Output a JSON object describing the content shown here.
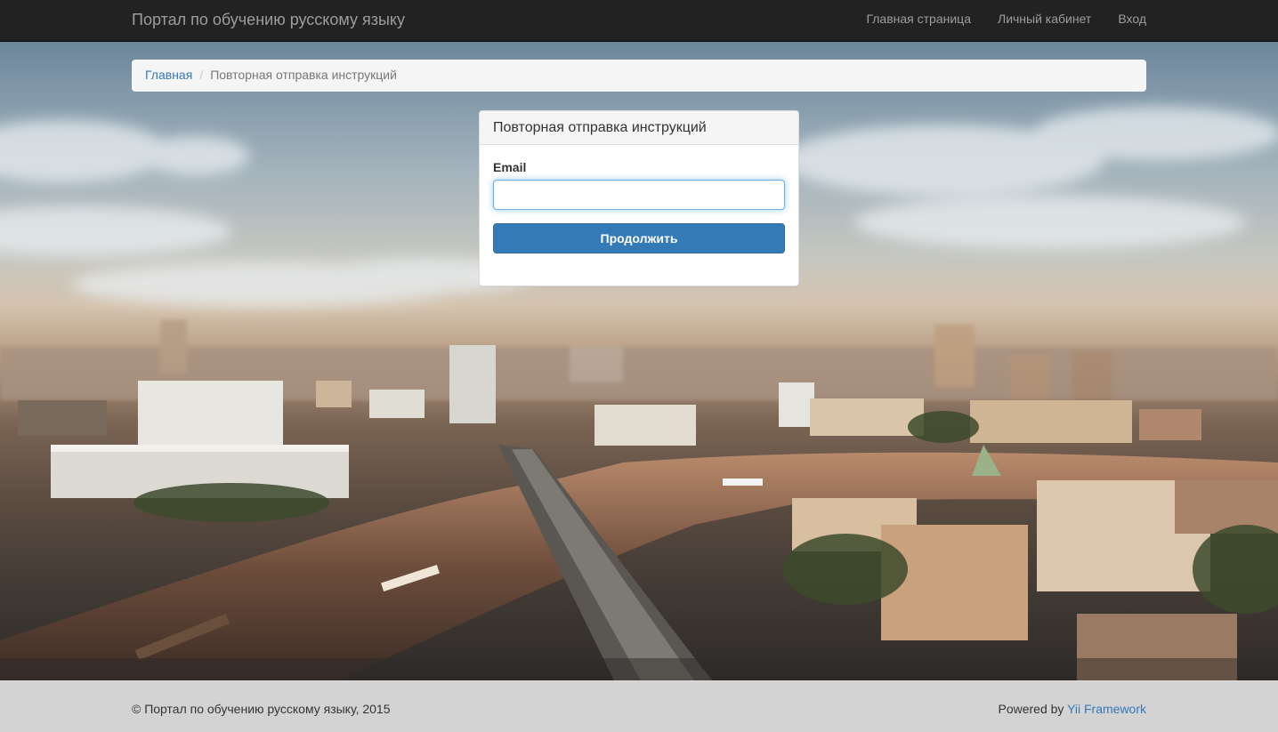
{
  "navbar": {
    "brand": "Портал по обучению русскому языку",
    "links": [
      "Главная страница",
      "Личный кабинет",
      "Вход"
    ]
  },
  "breadcrumb": {
    "home": "Главная",
    "separator": "/",
    "current": "Повторная отправка инструкций"
  },
  "panel": {
    "title": "Повторная отправка инструкций",
    "email_label": "Email",
    "email_value": "",
    "submit_label": "Продолжить"
  },
  "footer": {
    "copyright": "© Портал по обучению русскому языку, 2015",
    "powered_prefix": "Powered by ",
    "powered_link": "Yii Framework"
  },
  "colors": {
    "navbar": "#222222",
    "link": "#337ab7",
    "primary_button": "#337ab7",
    "footer": "#d3d3d3"
  }
}
